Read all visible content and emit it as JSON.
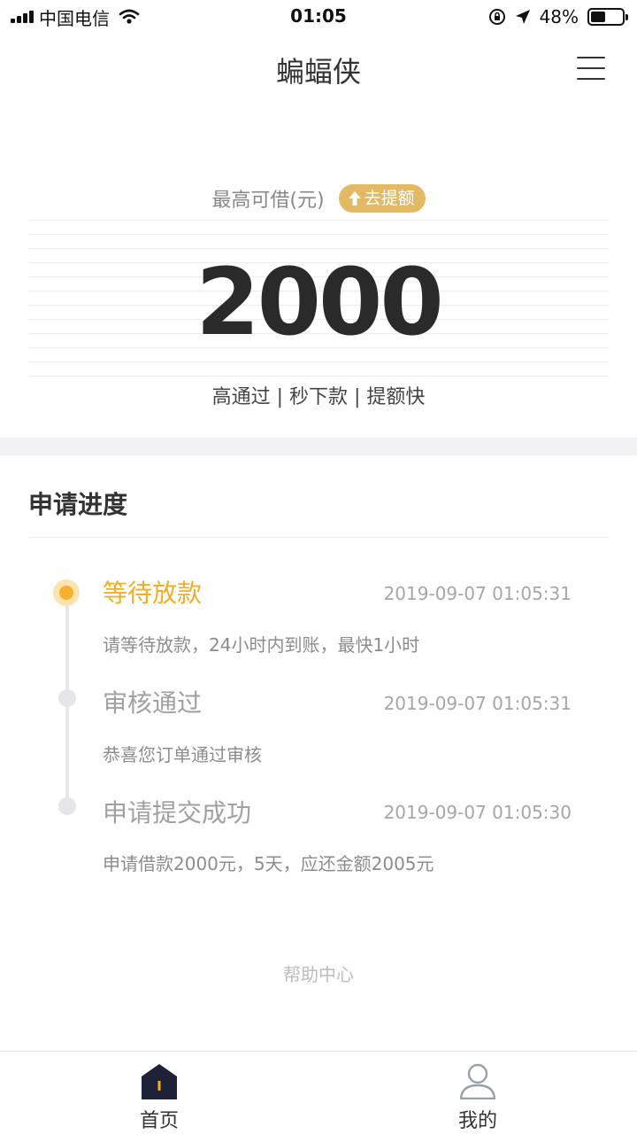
{
  "status_bar": {
    "carrier": "中国电信",
    "time": "01:05",
    "battery_percent": "48%",
    "battery_level": 0.48
  },
  "nav": {
    "title": "蝙蝠侠"
  },
  "hero": {
    "label": "最高可借(元)",
    "raise_badge": "去提额",
    "amount": "2000",
    "tagline": "高通过 | 秒下款 | 提额快"
  },
  "progress": {
    "title": "申请进度",
    "steps": [
      {
        "title": "等待放款",
        "time": "2019-09-07 01:05:31",
        "desc": "请等待放款，24小时内到账，最快1小时",
        "active": true
      },
      {
        "title": "审核通过",
        "time": "2019-09-07 01:05:31",
        "desc": "恭喜您订单通过审核",
        "active": false
      },
      {
        "title": "申请提交成功",
        "time": "2019-09-07 01:05:30",
        "desc": "申请借款2000元，5天，应还金额2005元",
        "active": false
      }
    ]
  },
  "help_center": "帮助中心",
  "tab_bar": {
    "tabs": [
      {
        "label": "首页",
        "icon": "home-icon",
        "selected": true
      },
      {
        "label": "我的",
        "icon": "user-icon",
        "selected": false
      }
    ]
  },
  "colors": {
    "accent": "#f0ae28",
    "badge": "#e4b964",
    "tab_dark": "#1d2238"
  }
}
